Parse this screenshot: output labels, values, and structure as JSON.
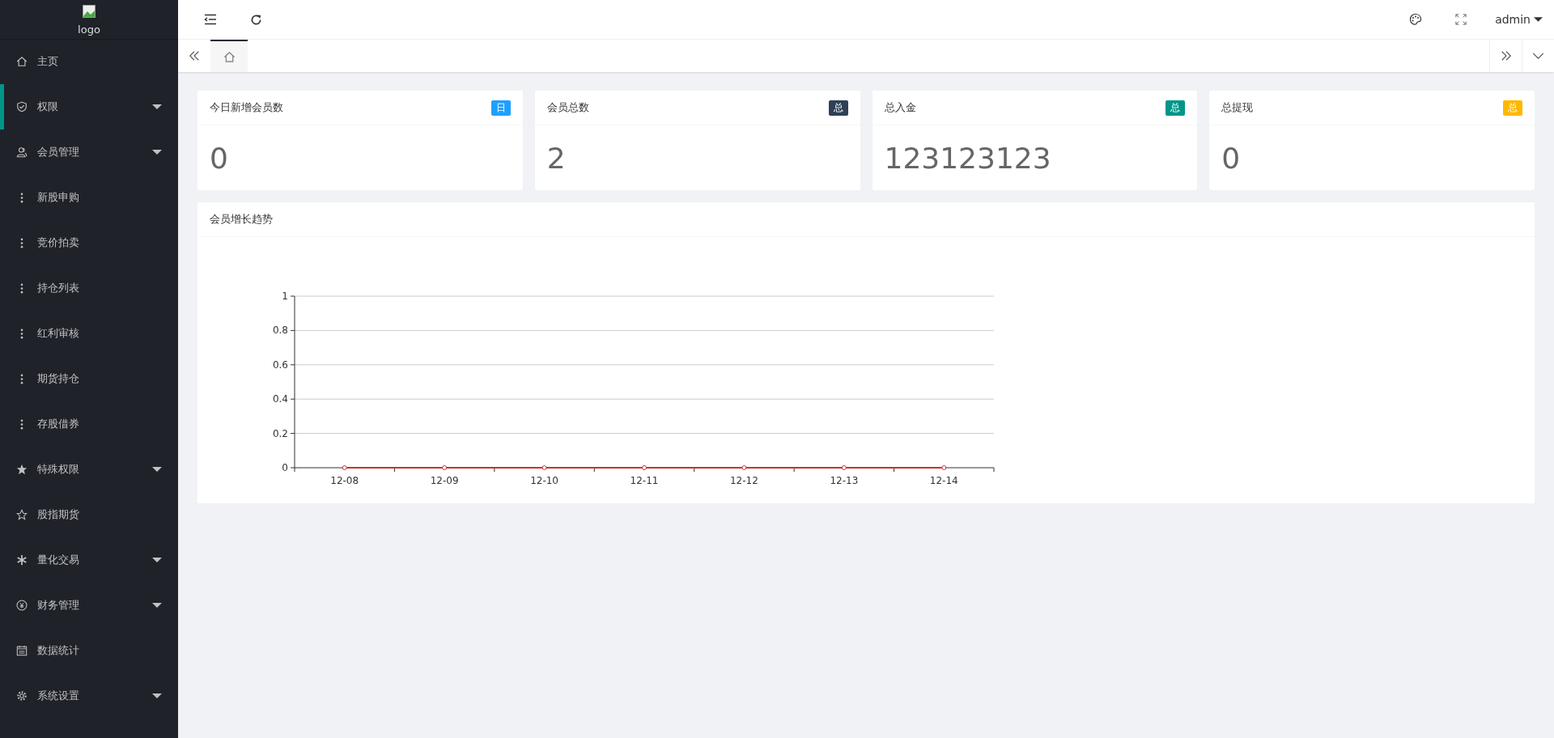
{
  "sidebar": {
    "logo_alt": "logo",
    "items": [
      {
        "label": "主页",
        "kind": "home",
        "expandable": false,
        "selected": false
      },
      {
        "label": "权限",
        "kind": "shield",
        "expandable": true,
        "selected": true
      },
      {
        "label": "会员管理",
        "kind": "user",
        "expandable": true,
        "selected": false,
        "children": [
          {
            "label": "新股申购",
            "kind": "dots",
            "expandable": false,
            "selected": false
          },
          {
            "label": "竞价拍卖",
            "kind": "dots",
            "expandable": false,
            "selected": false
          },
          {
            "label": "持仓列表",
            "kind": "dots",
            "expandable": false,
            "selected": false
          },
          {
            "label": "红利审核",
            "kind": "dots",
            "expandable": false,
            "selected": false
          },
          {
            "label": "期货持仓",
            "kind": "dots",
            "expandable": false,
            "selected": false
          },
          {
            "label": "存股借券",
            "kind": "dots",
            "expandable": false,
            "selected": false
          }
        ]
      },
      {
        "label": "特殊权限",
        "kind": "star",
        "expandable": true,
        "selected": false
      },
      {
        "label": "股指期货",
        "kind": "star-outline",
        "expandable": false,
        "selected": false
      },
      {
        "label": "量化交易",
        "kind": "snowflake",
        "expandable": true,
        "selected": false
      },
      {
        "label": "财务管理",
        "kind": "coin",
        "expandable": true,
        "selected": false
      },
      {
        "label": "数据统计",
        "kind": "calendar",
        "expandable": false,
        "selected": false
      },
      {
        "label": "系统设置",
        "kind": "gear",
        "expandable": true,
        "selected": false
      }
    ]
  },
  "header": {
    "user": "admin"
  },
  "tabs": [
    {
      "kind": "home",
      "selected": true
    }
  ],
  "cards": [
    {
      "title": "今日新增会员数",
      "badge": "日",
      "color": "#1e9fff",
      "value": "0"
    },
    {
      "title": "会员总数",
      "badge": "总",
      "color": "#2f4056",
      "value": "2"
    },
    {
      "title": "总入金",
      "badge": "总",
      "color": "#009688",
      "value": "123123123"
    },
    {
      "title": "总提现",
      "badge": "总",
      "color": "#ffb800",
      "value": "0"
    }
  ],
  "trend": {
    "title": "会员增长趋势",
    "chart_data": {
      "type": "line",
      "grid": true,
      "categories": [
        "12-08",
        "12-09",
        "12-10",
        "12-11",
        "12-12",
        "12-13",
        "12-14"
      ],
      "series": [
        {
          "color": "#c23531",
          "marker": true,
          "values": [
            0,
            0,
            0,
            0,
            0,
            0,
            0
          ]
        }
      ],
      "ylim": [
        0,
        1
      ],
      "yticks": [
        0,
        0.2,
        0.4,
        0.6,
        0.8,
        1
      ]
    }
  }
}
